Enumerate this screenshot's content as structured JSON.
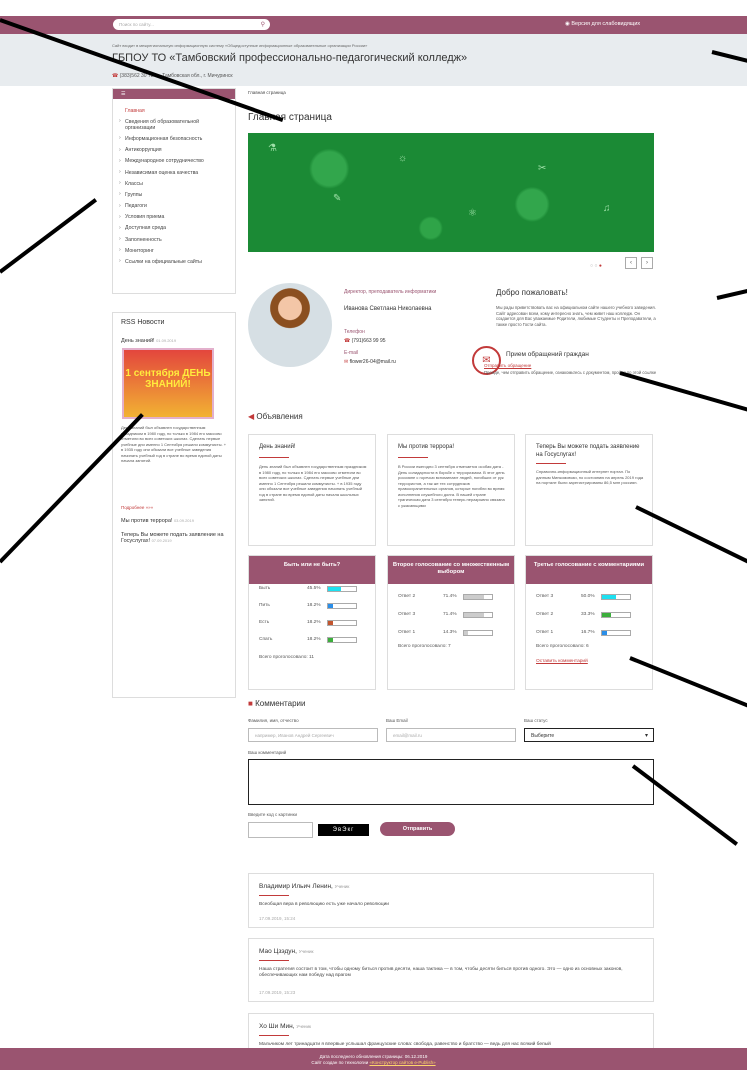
{
  "header": {
    "search_placeholder": "Поиск по сайту...",
    "vision_label": "Версия для слабовидящих",
    "subtitle": "Сайт входит в межрегиональную информационную систему «Общедоступные информационные образовательные организации России»",
    "title": "ГБПОУ ТО «Тамбовский профессионально-педагогический колледж»",
    "phone": "(383)562 30 72",
    "address": "Тамбовская обл., г. Мичуринск"
  },
  "menu": {
    "items": [
      "Главная",
      "Сведения об образовательной организации",
      "Информационная безопасность",
      "Антикоррупция",
      "Международное сотрудничество",
      "Независимая оценка качества",
      "Классы",
      "Группы",
      "Педагоги",
      "Условия приема",
      "Доступная среда",
      "Заполненность",
      "Мониторинг",
      "Ссылки на официальные сайты"
    ]
  },
  "rss": {
    "title": "RSS Новости",
    "item1_title": "День знаний!",
    "item1_date": "01.09.2019",
    "image_text": "1 сентября ДЕНЬ ЗНАНИЙ!",
    "item1_text": "День знаний был объявлен государственным праздником в 1980 году, но только в 1984 его массово отметили во всех советских школах. Сделать первые учебные дни именно 1 Сентября решили коммунисты. + в 1935 году они обязали все учебные заведения начинать учебный год в стране во время единой даты начала занятий.",
    "more": "Подробнее »»»",
    "item2_title": "Мы против террора!",
    "item2_date": "03.09.2019",
    "item3_title": "Теперь Вы можете подать заявление на Госуслугах!",
    "item3_date": "07.09.2019"
  },
  "breadcrumb": "Главная страница",
  "page_title": "Главная страница",
  "director": {
    "position": "Директор, преподаватель информатики",
    "name": "Иванова Светлана Николаевна",
    "phone_label": "Телефон",
    "phone": "(791)663 99 95",
    "email_label": "E-mail",
    "email": "flower26-04@mail.ru"
  },
  "welcome": {
    "title": "Добро пожаловать!",
    "text": "Мы рады приветствовать вас на официальном сайте нашего учебного заведения. Сайт адресован всем, кому интересно знать, чем живет наш колледж. Он создается для Вас уважаемые Родители, любимые Студенты и Преподаватели, а также просто Гости сайта."
  },
  "appeal": {
    "title": "Прием обращений граждан",
    "link": "Отправить обращение",
    "text": "Прежде, чем отправить обращение, ознакомьтесь с документом, пройдя по этой ссылке"
  },
  "announcements": {
    "title": "Объявления",
    "cards": [
      {
        "title": "День знаний!",
        "text": "День знаний был объявлен государственным праздником в 1980 году, но только в 1984 его массово отметили во всех советских школах. Сделать первые учебные дни именно 1 Сентября решили коммунисты. + в 1935 году они обязали все учебные заведения начинать учебный год в стране во время единой даты начала школьных занятий."
      },
      {
        "title": "Мы против террора!",
        "text": "В России ежегодно 3 сентября отмечается особая дата - День солидарности в борьбе с терроризмом. В этот день россияне с горечью вспоминают людей, погибших от рук террористов, а так же тех сотрудников правоохранительных органов, которые погибли во время исполнения служебного долга. В нашей стране трагическая дата 3 сентября теперь неразрывно связана с ужасающими"
      },
      {
        "title": "Теперь Вы можете подать заявление на Госуслугах!",
        "text": "Справочно-информационный интернет портал. По данным Минкомсвязи, по состоянию на апрель 2019 года на портале были зарегистрированы 86,5 млн россиян."
      }
    ]
  },
  "polls": [
    {
      "title": "Быть или не быть?",
      "options": [
        {
          "label": "Быть",
          "pct": "45.5%",
          "value": 45.5,
          "color": "#1ee0f0"
        },
        {
          "label": "Пить",
          "pct": "18.2%",
          "value": 18.2,
          "color": "#2a8ee8"
        },
        {
          "label": "Есть",
          "pct": "18.2%",
          "value": 18.2,
          "color": "#c2552e"
        },
        {
          "label": "Спать",
          "pct": "18.2%",
          "value": 18.2,
          "color": "#3cae3c"
        }
      ],
      "total": "Всего проголосовало: 11"
    },
    {
      "title": "Второе голосование со множественным выбором",
      "options": [
        {
          "label": "Ответ 2",
          "pct": "71.4%",
          "value": 71.4,
          "color": "#cccccc"
        },
        {
          "label": "Ответ 3",
          "pct": "71.4%",
          "value": 71.4,
          "color": "#cccccc"
        },
        {
          "label": "Ответ 1",
          "pct": "14.3%",
          "value": 14.3,
          "color": "#cccccc"
        }
      ],
      "total": "Всего проголосовало: 7"
    },
    {
      "title": "Третье голосование с комментариями",
      "options": [
        {
          "label": "Ответ 3",
          "pct": "50.0%",
          "value": 50.0,
          "color": "#1ee0f0"
        },
        {
          "label": "Ответ 2",
          "pct": "33.3%",
          "value": 33.3,
          "color": "#3cae3c"
        },
        {
          "label": "Ответ 1",
          "pct": "16.7%",
          "value": 16.7,
          "color": "#2a8ee8"
        }
      ],
      "total": "Всего проголосовало: 6",
      "link": "Оставить комментарий"
    }
  ],
  "comments_form": {
    "title": "Комментарии",
    "name_label": "Фамилия, имя, отчество",
    "name_placeholder": "например, Иванов Андрей Сергеевич",
    "email_label": "Ваш Email",
    "email_placeholder": "email@mail.ru",
    "status_label": "Ваш статус",
    "status_value": "Выберите",
    "comment_label": "Ваш комментарий",
    "captcha_label": "Введите код с картинки",
    "captcha_text": "ЭвЭкг",
    "send_label": "Отправить"
  },
  "comments": [
    {
      "author": "Владимир Ильич Ленин,",
      "role": "Ученик",
      "text": "Всеобщая вера в революцию есть уже начало революции",
      "date": "17.09.2019, 15:24"
    },
    {
      "author": "Мао Цзэдун,",
      "role": "Ученик",
      "text": "Наша стратегия состоит в том, чтобы одному биться против десяти, наша тактика — в том, чтобы десяти биться против одного. Это — одно из основных законов, обеспечивающих нам победу над врагом",
      "date": "17.09.2019, 15:23"
    },
    {
      "author": "Хо Ши Мин,",
      "role": "Ученик",
      "text": "Мальчиком лет тринадцати я впервые услышал французские слова: свобода, равенство и братство — ведь для нас всякий белый"
    }
  ],
  "footer": {
    "line1": "Дата последнего обновления страницы: 06.12.2019",
    "line2_prefix": "Сайт создан по технологии",
    "line2_link": "«Конструктор сайтов е-Publish»"
  },
  "colors": {
    "brand": "#9a5470",
    "accent": "#c23a3a",
    "banner": "#1b8a35"
  }
}
